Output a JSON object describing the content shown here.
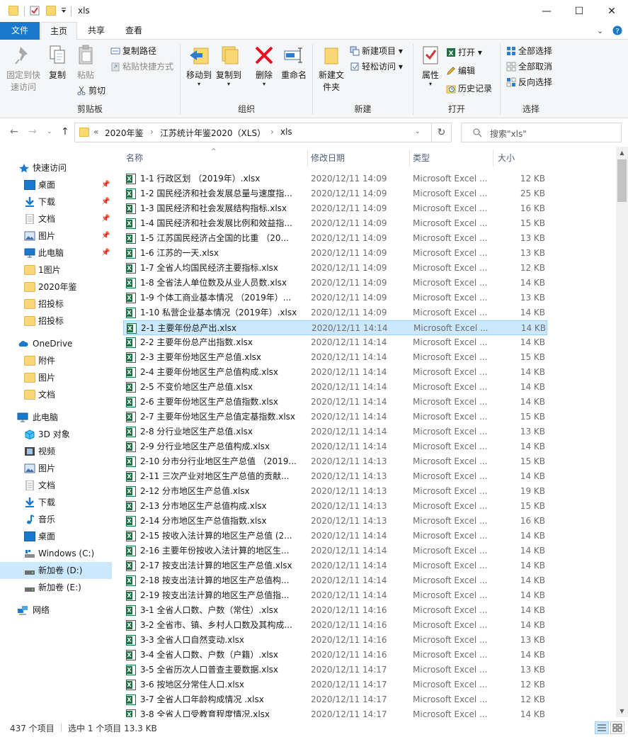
{
  "window": {
    "title": "xls",
    "minimize": "—",
    "maximize": "☐",
    "close": "✕"
  },
  "ribbon_tabs": {
    "file": "文件",
    "home": "主页",
    "share": "共享",
    "view": "查看"
  },
  "ribbon": {
    "clipboard": {
      "label": "剪贴板",
      "pin": "固定到快速访问",
      "copy": "复制",
      "paste": "粘贴",
      "copy_path": "复制路径",
      "paste_shortcut": "粘贴快捷方式",
      "cut": "剪切"
    },
    "organize": {
      "label": "组织",
      "move_to": "移动到",
      "copy_to": "复制到",
      "delete": "删除",
      "rename": "重命名"
    },
    "new": {
      "label": "新建",
      "new_folder": "新建文件夹",
      "new_item": "新建项目",
      "easy_access": "轻松访问"
    },
    "open": {
      "label": "打开",
      "properties": "属性",
      "open": "打开",
      "edit": "编辑",
      "history": "历史记录"
    },
    "select": {
      "label": "选择",
      "select_all": "全部选择",
      "select_none": "全部取消",
      "invert": "反向选择"
    }
  },
  "address": {
    "overflow": "«",
    "crumbs": [
      "2020年鉴",
      "江苏统计年鉴2020（XLS）",
      "xls"
    ],
    "search_placeholder": "搜索\"xls\""
  },
  "nav": {
    "quick_access": "快速访问",
    "items": [
      {
        "label": "桌面",
        "pinned": true
      },
      {
        "label": "下载",
        "pinned": true
      },
      {
        "label": "文档",
        "pinned": true
      },
      {
        "label": "图片",
        "pinned": true
      },
      {
        "label": "此电脑",
        "pinned": true
      },
      {
        "label": "1图片"
      },
      {
        "label": "2020年鉴"
      },
      {
        "label": "招投标"
      },
      {
        "label": "招投标"
      }
    ],
    "onedrive": "OneDrive",
    "onedrive_items": [
      "附件",
      "图片",
      "文档"
    ],
    "this_pc": "此电脑",
    "pc_items": [
      "3D 对象",
      "视频",
      "图片",
      "文档",
      "下载",
      "音乐",
      "桌面",
      "Windows (C:)",
      "新加卷 (D:)",
      "新加卷 (E:)"
    ],
    "network": "网络"
  },
  "columns": {
    "name": "名称",
    "date": "修改日期",
    "type": "类型",
    "size": "大小"
  },
  "files": [
    {
      "name": "1-1   行政区划    （2019年）.xlsx",
      "date": "2020/12/11 14:09",
      "type": "Microsoft Excel ...",
      "size": "12 KB"
    },
    {
      "name": "1-2   国民经济和社会发展总量与速度指...",
      "date": "2020/12/11 14:09",
      "type": "Microsoft Excel ...",
      "size": "25 KB"
    },
    {
      "name": "1-3   国民经济和社会发展结构指标.xlsx",
      "date": "2020/12/11 14:09",
      "type": "Microsoft Excel ...",
      "size": "16 KB"
    },
    {
      "name": "1-4   国民经济和社会发展比例和效益指...",
      "date": "2020/12/11 14:09",
      "type": "Microsoft Excel ...",
      "size": "15 KB"
    },
    {
      "name": "1-5   江苏国民经济占全国的比重    （20...",
      "date": "2020/12/11 14:09",
      "type": "Microsoft Excel ...",
      "size": "13 KB"
    },
    {
      "name": "1-6   江苏的一天.xlsx",
      "date": "2020/12/11 14:09",
      "type": "Microsoft Excel ...",
      "size": "13 KB"
    },
    {
      "name": "1-7   全省人均国民经济主要指标.xlsx",
      "date": "2020/12/11 14:09",
      "type": "Microsoft Excel ...",
      "size": "12 KB"
    },
    {
      "name": "1-8   全省法人单位数及从业人员数.xlsx",
      "date": "2020/12/11 14:09",
      "type": "Microsoft Excel ...",
      "size": "14 KB"
    },
    {
      "name": "1-9   个体工商业基本情况    （2019年）...",
      "date": "2020/12/11 14:09",
      "type": "Microsoft Excel ...",
      "size": "13 KB"
    },
    {
      "name": "1-10  私营企业基本情况（2019年）.xlsx",
      "date": "2020/12/11 14:09",
      "type": "Microsoft Excel ...",
      "size": "14 KB"
    },
    {
      "name": "2-1   主要年份总产出.xlsx",
      "date": "2020/12/11 14:14",
      "type": "Microsoft Excel ...",
      "size": "14 KB",
      "selected": true
    },
    {
      "name": "2-2   主要年份总产出指数.xlsx",
      "date": "2020/12/11 14:14",
      "type": "Microsoft Excel ...",
      "size": "14 KB"
    },
    {
      "name": "2-3   主要年份地区生产总值.xlsx",
      "date": "2020/12/11 14:14",
      "type": "Microsoft Excel ...",
      "size": "15 KB"
    },
    {
      "name": "2-4   主要年份地区生产总值构成.xlsx",
      "date": "2020/12/11 14:14",
      "type": "Microsoft Excel ...",
      "size": "14 KB"
    },
    {
      "name": "2-5   不变价地区生产总值.xlsx",
      "date": "2020/12/11 14:14",
      "type": "Microsoft Excel ...",
      "size": "14 KB"
    },
    {
      "name": "2-6   主要年份地区生产总值指数.xlsx",
      "date": "2020/12/11 14:14",
      "type": "Microsoft Excel ...",
      "size": "14 KB"
    },
    {
      "name": "2-7   主要年份地区生产总值定基指数.xlsx",
      "date": "2020/12/11 14:14",
      "type": "Microsoft Excel ...",
      "size": "15 KB"
    },
    {
      "name": "2-8   分行业地区生产总值.xlsx",
      "date": "2020/12/11 14:14",
      "type": "Microsoft Excel ...",
      "size": "13 KB"
    },
    {
      "name": "2-9   分行业地区生产总值构成.xlsx",
      "date": "2020/12/11 14:14",
      "type": "Microsoft Excel ...",
      "size": "14 KB"
    },
    {
      "name": "2-10   分市分行业地区生产总值    （2019...",
      "date": "2020/12/11 14:13",
      "type": "Microsoft Excel ...",
      "size": "15 KB"
    },
    {
      "name": "2-11   三次产业对地区生产总值的贡献...",
      "date": "2020/12/11 14:13",
      "type": "Microsoft Excel ...",
      "size": "14 KB"
    },
    {
      "name": "2-12  分市地区生产总值.xlsx",
      "date": "2020/12/11 14:13",
      "type": "Microsoft Excel ...",
      "size": "19 KB"
    },
    {
      "name": "2-13  分市地区生产总值构成.xlsx",
      "date": "2020/12/11 14:13",
      "type": "Microsoft Excel ...",
      "size": "15 KB"
    },
    {
      "name": "2-14  分市地区生产总值指数.xlsx",
      "date": "2020/12/11 14:13",
      "type": "Microsoft Excel ...",
      "size": "16 KB"
    },
    {
      "name": "2-15   按收入法计算的地区生产总值  (2...",
      "date": "2020/12/11 14:14",
      "type": "Microsoft Excel ...",
      "size": "14 KB"
    },
    {
      "name": "2-16   主要年份按收入法计算的地区生...",
      "date": "2020/12/11 14:14",
      "type": "Microsoft Excel ...",
      "size": "14 KB"
    },
    {
      "name": "2-17   按支出法计算的地区生产总值.xlsx",
      "date": "2020/12/11 14:14",
      "type": "Microsoft Excel ...",
      "size": "14 KB"
    },
    {
      "name": "2-18   按支出法计算的地区生产总值构...",
      "date": "2020/12/11 14:14",
      "type": "Microsoft Excel ...",
      "size": "14 KB"
    },
    {
      "name": "2-19   按支出法计算的地区生产总值指...",
      "date": "2020/12/11 14:14",
      "type": "Microsoft Excel ...",
      "size": "14 KB"
    },
    {
      "name": "3-1   全省人口数、户数（常住）.xlsx",
      "date": "2020/12/11 14:16",
      "type": "Microsoft Excel ...",
      "size": "14 KB"
    },
    {
      "name": "3-2   全省市、镇、乡村人口数及其构成...",
      "date": "2020/12/11 14:16",
      "type": "Microsoft Excel ...",
      "size": "14 KB"
    },
    {
      "name": "3-3   全省人口自然变动.xlsx",
      "date": "2020/12/11 14:16",
      "type": "Microsoft Excel ...",
      "size": "13 KB"
    },
    {
      "name": "3-4   全省人口数、户数（户籍）.xlsx",
      "date": "2020/12/11 14:16",
      "type": "Microsoft Excel ...",
      "size": "14 KB"
    },
    {
      "name": "3-5   全省历次人口普查主要数据.xlsx",
      "date": "2020/12/11 14:17",
      "type": "Microsoft Excel ...",
      "size": "13 KB"
    },
    {
      "name": "3-6  按地区分常住人口.xlsx",
      "date": "2020/12/11 14:17",
      "type": "Microsoft Excel ...",
      "size": "12 KB"
    },
    {
      "name": "3-7   全省人口年龄构成情况    .xlsx",
      "date": "2020/12/11 14:17",
      "type": "Microsoft Excel ...",
      "size": "12 KB"
    },
    {
      "name": "3-8   全省人口受教育程度情况.xlsx",
      "date": "2020/12/11 14:17",
      "type": "Microsoft Excel ...",
      "size": "14 KB"
    }
  ],
  "status": {
    "count": "437 个项目",
    "selection": "选中 1 个项目  13.3 KB"
  }
}
